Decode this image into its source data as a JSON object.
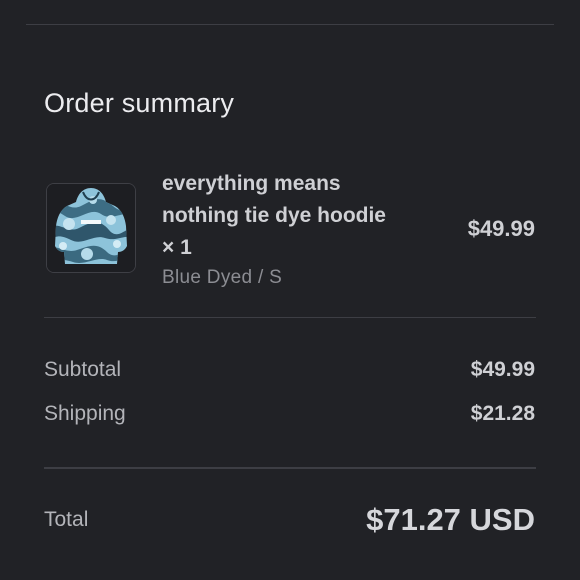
{
  "order_summary": {
    "title": "Order summary",
    "item": {
      "name": "everything means nothing tie dye hoodie × 1",
      "variant": "Blue Dyed / S",
      "price": "$49.99",
      "image_icon": "hoodie-product-image"
    },
    "subtotal": {
      "label": "Subtotal",
      "value": "$49.99"
    },
    "shipping": {
      "label": "Shipping",
      "value": "$21.28"
    },
    "total": {
      "label": "Total",
      "value": "$71.27 USD"
    }
  },
  "colors": {
    "background": "#212226",
    "divider": "#3d3e44",
    "primary_text": "#cfd0d4",
    "secondary_text": "#8c8d93",
    "hoodie_blue": "#7fb6cf"
  }
}
